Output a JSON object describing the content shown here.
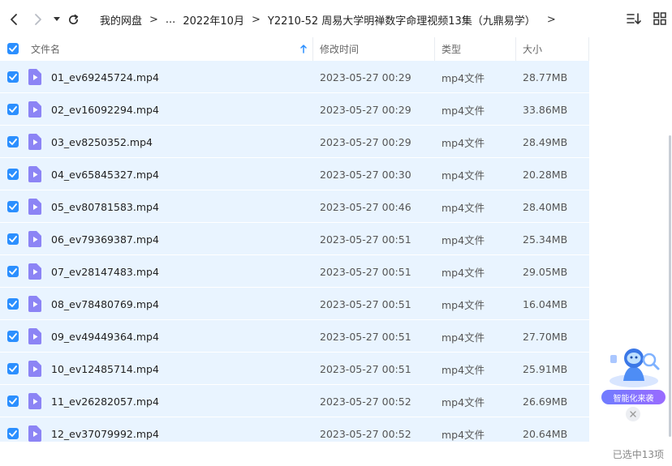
{
  "breadcrumb": {
    "items": [
      "我的网盘",
      "...",
      "2022年10月",
      "Y2210-52 周易大学明禅数字命理视频13集（九鼎易学）"
    ],
    "separator": ">"
  },
  "table": {
    "headers": {
      "name": "文件名",
      "time": "修改时间",
      "type": "类型",
      "size": "大小"
    },
    "rows": [
      {
        "name": "01_ev69245724.mp4",
        "time": "2023-05-27 00:29",
        "type": "mp4文件",
        "size": "28.77MB"
      },
      {
        "name": "02_ev16092294.mp4",
        "time": "2023-05-27 00:29",
        "type": "mp4文件",
        "size": "33.86MB"
      },
      {
        "name": "03_ev8250352.mp4",
        "time": "2023-05-27 00:29",
        "type": "mp4文件",
        "size": "28.49MB"
      },
      {
        "name": "04_ev65845327.mp4",
        "time": "2023-05-27 00:30",
        "type": "mp4文件",
        "size": "20.28MB"
      },
      {
        "name": "05_ev80781583.mp4",
        "time": "2023-05-27 00:46",
        "type": "mp4文件",
        "size": "28.40MB"
      },
      {
        "name": "06_ev79369387.mp4",
        "time": "2023-05-27 00:51",
        "type": "mp4文件",
        "size": "25.34MB"
      },
      {
        "name": "07_ev28147483.mp4",
        "time": "2023-05-27 00:51",
        "type": "mp4文件",
        "size": "29.05MB"
      },
      {
        "name": "08_ev78480769.mp4",
        "time": "2023-05-27 00:51",
        "type": "mp4文件",
        "size": "16.04MB"
      },
      {
        "name": "09_ev49449364.mp4",
        "time": "2023-05-27 00:51",
        "type": "mp4文件",
        "size": "27.70MB"
      },
      {
        "name": "10_ev12485714.mp4",
        "time": "2023-05-27 00:51",
        "type": "mp4文件",
        "size": "25.91MB"
      },
      {
        "name": "11_ev26282057.mp4",
        "time": "2023-05-27 00:52",
        "type": "mp4文件",
        "size": "26.69MB"
      },
      {
        "name": "12_ev37079992.mp4",
        "time": "2023-05-27 00:52",
        "type": "mp4文件",
        "size": "20.64MB"
      }
    ]
  },
  "status": {
    "selected_text": "已选中13项"
  },
  "widget": {
    "label": "智能化来袭"
  },
  "colors": {
    "accent": "#2b8fff",
    "row_selected": "#e9f4ff",
    "file_icon": "#8c84f5"
  },
  "icons": {
    "back": "chevron-left-icon",
    "forward": "chevron-right-icon",
    "dropdown": "caret-down-icon",
    "refresh": "refresh-icon",
    "sort": "sort-icon",
    "grid": "grid-view-icon",
    "file": "video-file-icon",
    "checkbox": "checkbox-checked-icon",
    "close": "close-icon"
  }
}
